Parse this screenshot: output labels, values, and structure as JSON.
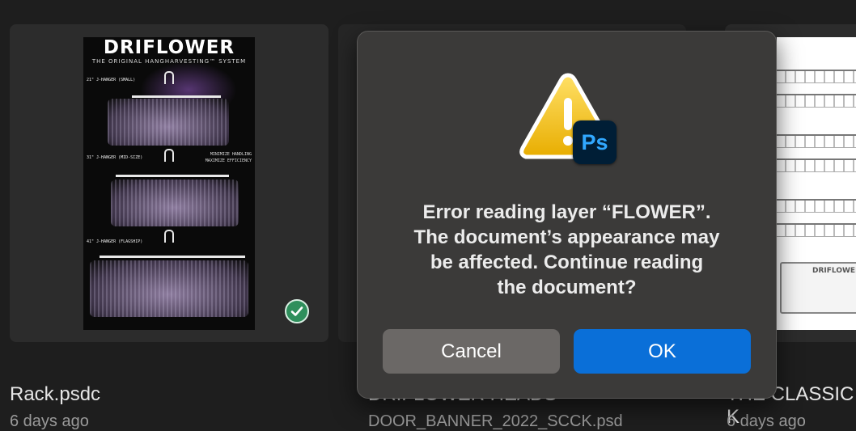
{
  "files": [
    {
      "name": "Rack.psdc",
      "date": "6 days ago"
    },
    {
      "name": "DRIFLOWER HEADS",
      "subname": "DOOR_BANNER_2022_SCCK.psd"
    },
    {
      "name": "THE CLASSIC K",
      "date": "6 days ago"
    }
  ],
  "thumbnail": {
    "brand": "DRIFLOWER",
    "tagline": "THE ORIGINAL HANGHARVESTING™ SYSTEM",
    "hanger_small": "21\" J-HANGER (SMALL)",
    "hanger_mid": "31\" J-HANGER (MID-SIZE)",
    "hanger_flagship": "41\" J-HANGER (FLAGSHIP)",
    "side_line_1": "MINIMIZE HANDLING",
    "side_line_2": "MAXIMIZE EFFICIENCY",
    "right_label": "DRIFLOWER"
  },
  "dialog": {
    "app_badge": "Ps",
    "message_line_1": "Error reading layer “FLOWER”.",
    "message_line_2": "The document’s appearance may",
    "message_line_3": "be affected. Continue reading",
    "message_line_4": "the document?",
    "cancel_label": "Cancel",
    "ok_label": "OK"
  },
  "colors": {
    "primary_button": "#0a6fd8",
    "synced_badge": "#2f8f5c",
    "warning": "#f5c518",
    "ps_brand": "#31a8ff"
  },
  "icons": {
    "warning": "warning-triangle-icon",
    "app": "photoshop-icon",
    "synced": "checkmark-circle-icon"
  }
}
